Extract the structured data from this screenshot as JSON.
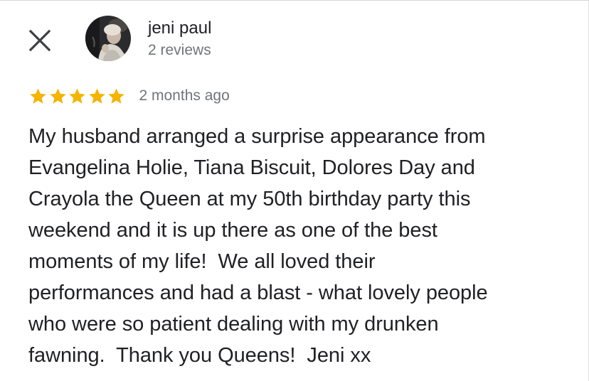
{
  "header": {
    "close_icon": "close-icon"
  },
  "reviewer": {
    "name": "jeni paul",
    "review_count": "2 reviews",
    "avatar": "avatar-photo"
  },
  "review": {
    "rating": 5,
    "rating_max": 5,
    "star_color": "#f4b400",
    "time_ago": "2 months ago",
    "text_lines": [
      "My husband arranged a surprise appearance from",
      "Evangelina Holie, Tiana Biscuit, Dolores Day and",
      "Crayola the Queen at my 50th birthday party this",
      "weekend and it is up there as one of the best",
      "moments of my life!  We all loved their",
      "performances and had a blast - what lovely people",
      "who were so patient dealing with my drunken",
      "fawning.  Thank you Queens!  Jeni xx"
    ]
  },
  "colors": {
    "primary_text": "#202124",
    "secondary_text": "#70757a",
    "background": "#ffffff"
  }
}
